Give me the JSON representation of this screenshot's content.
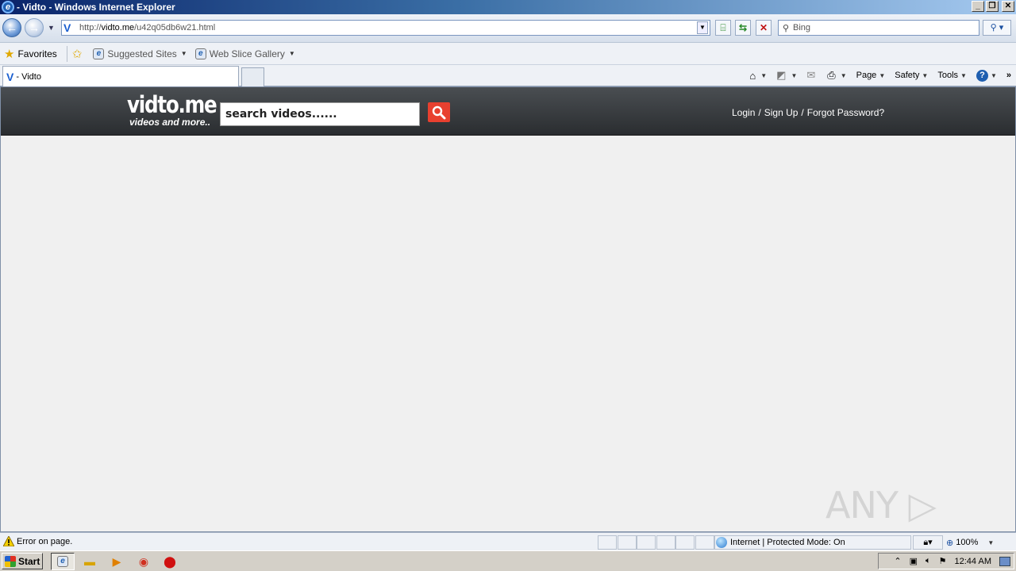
{
  "window": {
    "title": "- Vidto - Windows Internet Explorer",
    "minimize": "_",
    "restore": "❐",
    "close": "✕"
  },
  "navigation": {
    "url_prefix": "http://",
    "url_domain": "vidto.me",
    "url_path": "/u42q05db6w21.html",
    "search_placeholder": "Bing"
  },
  "favorites_bar": {
    "favorites_label": "Favorites",
    "items": [
      {
        "label": "Suggested Sites"
      },
      {
        "label": "Web Slice Gallery"
      }
    ]
  },
  "tabs": {
    "active_title": "- Vidto"
  },
  "command_bar": {
    "page": "Page",
    "safety": "Safety",
    "tools": "Tools",
    "help": "?"
  },
  "site": {
    "logo_main": "vidto.me",
    "logo_tagline": "videos and more..",
    "search_value": "search videos......",
    "login": "Login",
    "signup": "Sign Up",
    "forgot": "Forgot Password?",
    "separator": "/"
  },
  "status_bar": {
    "message": "Error on page.",
    "zone": "Internet | Protected Mode: On",
    "zoom": "100%"
  },
  "taskbar": {
    "start": "Start",
    "clock": "12:44 AM"
  },
  "watermark": "ANY ▷ RUN",
  "colors": {
    "site_header": "#2f3235",
    "search_button": "#e8402f",
    "page_background": "#f0f0f0"
  }
}
